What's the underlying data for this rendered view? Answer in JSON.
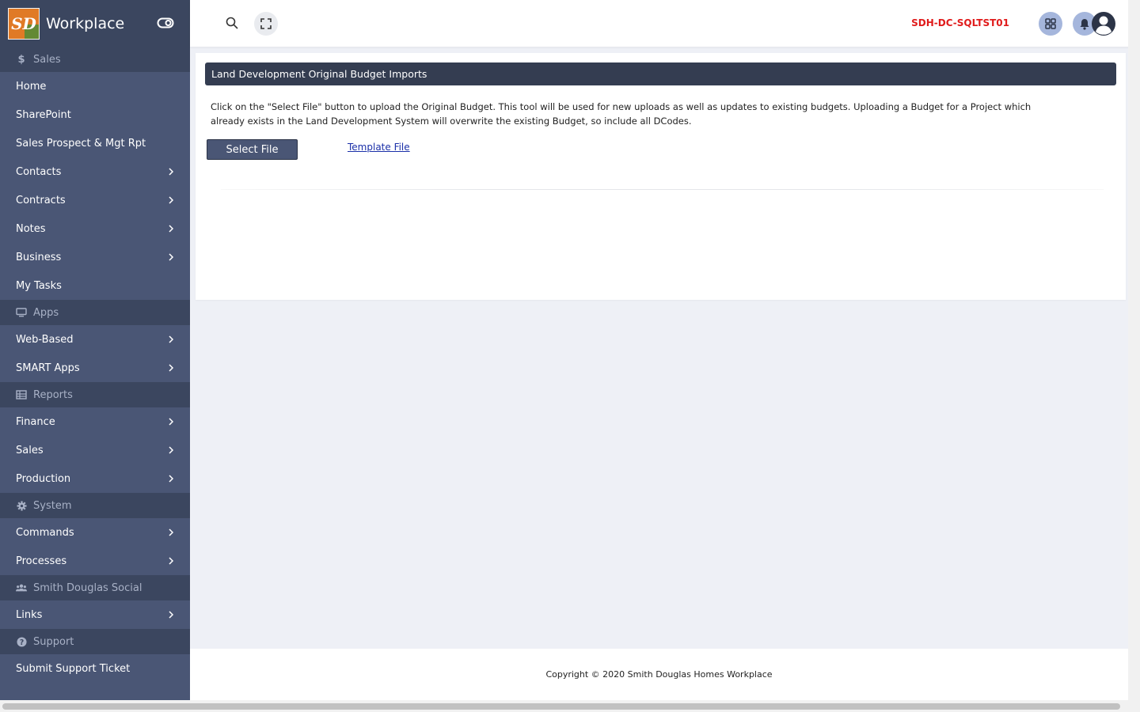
{
  "brand": {
    "name": "Workplace",
    "logo_text": "SD"
  },
  "sidebar": {
    "groups": [
      {
        "title": "Sales",
        "icon": "dollar-icon",
        "items": [
          {
            "label": "Home",
            "has_children": false
          },
          {
            "label": "SharePoint",
            "has_children": false
          },
          {
            "label": "Sales Prospect & Mgt Rpt",
            "has_children": false
          },
          {
            "label": "Contacts",
            "has_children": true
          },
          {
            "label": "Contracts",
            "has_children": true
          },
          {
            "label": "Notes",
            "has_children": true
          },
          {
            "label": "Business",
            "has_children": true
          },
          {
            "label": "My Tasks",
            "has_children": false
          }
        ]
      },
      {
        "title": "Apps",
        "icon": "monitor-icon",
        "items": [
          {
            "label": "Web-Based",
            "has_children": true
          },
          {
            "label": "SMART Apps",
            "has_children": true
          }
        ]
      },
      {
        "title": "Reports",
        "icon": "table-icon",
        "items": [
          {
            "label": "Finance",
            "has_children": true
          },
          {
            "label": "Sales",
            "has_children": true
          },
          {
            "label": "Production",
            "has_children": true
          }
        ]
      },
      {
        "title": "System",
        "icon": "gear-icon",
        "items": [
          {
            "label": "Commands",
            "has_children": true
          },
          {
            "label": "Processes",
            "has_children": true
          }
        ]
      },
      {
        "title": "Smith Douglas Social",
        "icon": "users-icon",
        "items": [
          {
            "label": "Links",
            "has_children": true
          }
        ]
      },
      {
        "title": "Support",
        "icon": "question-icon",
        "items": [
          {
            "label": "Submit Support Ticket",
            "has_children": false
          }
        ]
      }
    ]
  },
  "topbar": {
    "server_name": "SDH-DC-SQLTST01"
  },
  "main": {
    "header_title": "Land Development Original Budget Imports",
    "description": "Click on the \"Select File\" button to upload the Original Budget. This tool will be used for new uploads as well as updates to existing budgets. Uploading a Budget for a Project which already exists in the Land Development System will overwrite the existing Budget, so include all DCodes.",
    "select_button_label": "Select File",
    "template_link_label": "Template File"
  },
  "footer": {
    "copyright": "Copyright © 2020 Smith Douglas Homes Workplace"
  },
  "colors": {
    "sidebar": "#4a5675",
    "sidebar_section": "#3b465f",
    "header_bar": "#343d51",
    "server_text": "#e01b1b",
    "accent_button": "#a5b6dc"
  }
}
